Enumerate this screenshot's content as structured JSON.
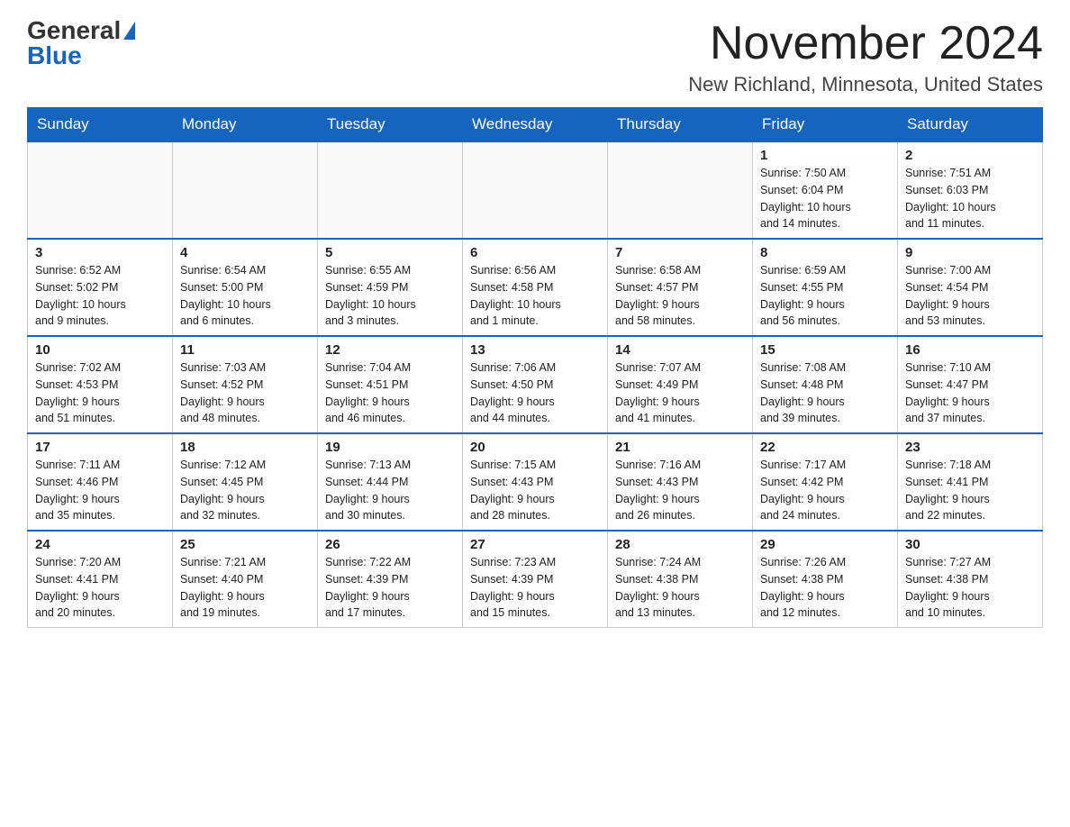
{
  "logo": {
    "general": "General",
    "blue": "Blue"
  },
  "title": "November 2024",
  "location": "New Richland, Minnesota, United States",
  "weekdays": [
    "Sunday",
    "Monday",
    "Tuesday",
    "Wednesday",
    "Thursday",
    "Friday",
    "Saturday"
  ],
  "weeks": [
    [
      {
        "day": "",
        "info": ""
      },
      {
        "day": "",
        "info": ""
      },
      {
        "day": "",
        "info": ""
      },
      {
        "day": "",
        "info": ""
      },
      {
        "day": "",
        "info": ""
      },
      {
        "day": "1",
        "info": "Sunrise: 7:50 AM\nSunset: 6:04 PM\nDaylight: 10 hours\nand 14 minutes."
      },
      {
        "day": "2",
        "info": "Sunrise: 7:51 AM\nSunset: 6:03 PM\nDaylight: 10 hours\nand 11 minutes."
      }
    ],
    [
      {
        "day": "3",
        "info": "Sunrise: 6:52 AM\nSunset: 5:02 PM\nDaylight: 10 hours\nand 9 minutes."
      },
      {
        "day": "4",
        "info": "Sunrise: 6:54 AM\nSunset: 5:00 PM\nDaylight: 10 hours\nand 6 minutes."
      },
      {
        "day": "5",
        "info": "Sunrise: 6:55 AM\nSunset: 4:59 PM\nDaylight: 10 hours\nand 3 minutes."
      },
      {
        "day": "6",
        "info": "Sunrise: 6:56 AM\nSunset: 4:58 PM\nDaylight: 10 hours\nand 1 minute."
      },
      {
        "day": "7",
        "info": "Sunrise: 6:58 AM\nSunset: 4:57 PM\nDaylight: 9 hours\nand 58 minutes."
      },
      {
        "day": "8",
        "info": "Sunrise: 6:59 AM\nSunset: 4:55 PM\nDaylight: 9 hours\nand 56 minutes."
      },
      {
        "day": "9",
        "info": "Sunrise: 7:00 AM\nSunset: 4:54 PM\nDaylight: 9 hours\nand 53 minutes."
      }
    ],
    [
      {
        "day": "10",
        "info": "Sunrise: 7:02 AM\nSunset: 4:53 PM\nDaylight: 9 hours\nand 51 minutes."
      },
      {
        "day": "11",
        "info": "Sunrise: 7:03 AM\nSunset: 4:52 PM\nDaylight: 9 hours\nand 48 minutes."
      },
      {
        "day": "12",
        "info": "Sunrise: 7:04 AM\nSunset: 4:51 PM\nDaylight: 9 hours\nand 46 minutes."
      },
      {
        "day": "13",
        "info": "Sunrise: 7:06 AM\nSunset: 4:50 PM\nDaylight: 9 hours\nand 44 minutes."
      },
      {
        "day": "14",
        "info": "Sunrise: 7:07 AM\nSunset: 4:49 PM\nDaylight: 9 hours\nand 41 minutes."
      },
      {
        "day": "15",
        "info": "Sunrise: 7:08 AM\nSunset: 4:48 PM\nDaylight: 9 hours\nand 39 minutes."
      },
      {
        "day": "16",
        "info": "Sunrise: 7:10 AM\nSunset: 4:47 PM\nDaylight: 9 hours\nand 37 minutes."
      }
    ],
    [
      {
        "day": "17",
        "info": "Sunrise: 7:11 AM\nSunset: 4:46 PM\nDaylight: 9 hours\nand 35 minutes."
      },
      {
        "day": "18",
        "info": "Sunrise: 7:12 AM\nSunset: 4:45 PM\nDaylight: 9 hours\nand 32 minutes."
      },
      {
        "day": "19",
        "info": "Sunrise: 7:13 AM\nSunset: 4:44 PM\nDaylight: 9 hours\nand 30 minutes."
      },
      {
        "day": "20",
        "info": "Sunrise: 7:15 AM\nSunset: 4:43 PM\nDaylight: 9 hours\nand 28 minutes."
      },
      {
        "day": "21",
        "info": "Sunrise: 7:16 AM\nSunset: 4:43 PM\nDaylight: 9 hours\nand 26 minutes."
      },
      {
        "day": "22",
        "info": "Sunrise: 7:17 AM\nSunset: 4:42 PM\nDaylight: 9 hours\nand 24 minutes."
      },
      {
        "day": "23",
        "info": "Sunrise: 7:18 AM\nSunset: 4:41 PM\nDaylight: 9 hours\nand 22 minutes."
      }
    ],
    [
      {
        "day": "24",
        "info": "Sunrise: 7:20 AM\nSunset: 4:41 PM\nDaylight: 9 hours\nand 20 minutes."
      },
      {
        "day": "25",
        "info": "Sunrise: 7:21 AM\nSunset: 4:40 PM\nDaylight: 9 hours\nand 19 minutes."
      },
      {
        "day": "26",
        "info": "Sunrise: 7:22 AM\nSunset: 4:39 PM\nDaylight: 9 hours\nand 17 minutes."
      },
      {
        "day": "27",
        "info": "Sunrise: 7:23 AM\nSunset: 4:39 PM\nDaylight: 9 hours\nand 15 minutes."
      },
      {
        "day": "28",
        "info": "Sunrise: 7:24 AM\nSunset: 4:38 PM\nDaylight: 9 hours\nand 13 minutes."
      },
      {
        "day": "29",
        "info": "Sunrise: 7:26 AM\nSunset: 4:38 PM\nDaylight: 9 hours\nand 12 minutes."
      },
      {
        "day": "30",
        "info": "Sunrise: 7:27 AM\nSunset: 4:38 PM\nDaylight: 9 hours\nand 10 minutes."
      }
    ]
  ]
}
